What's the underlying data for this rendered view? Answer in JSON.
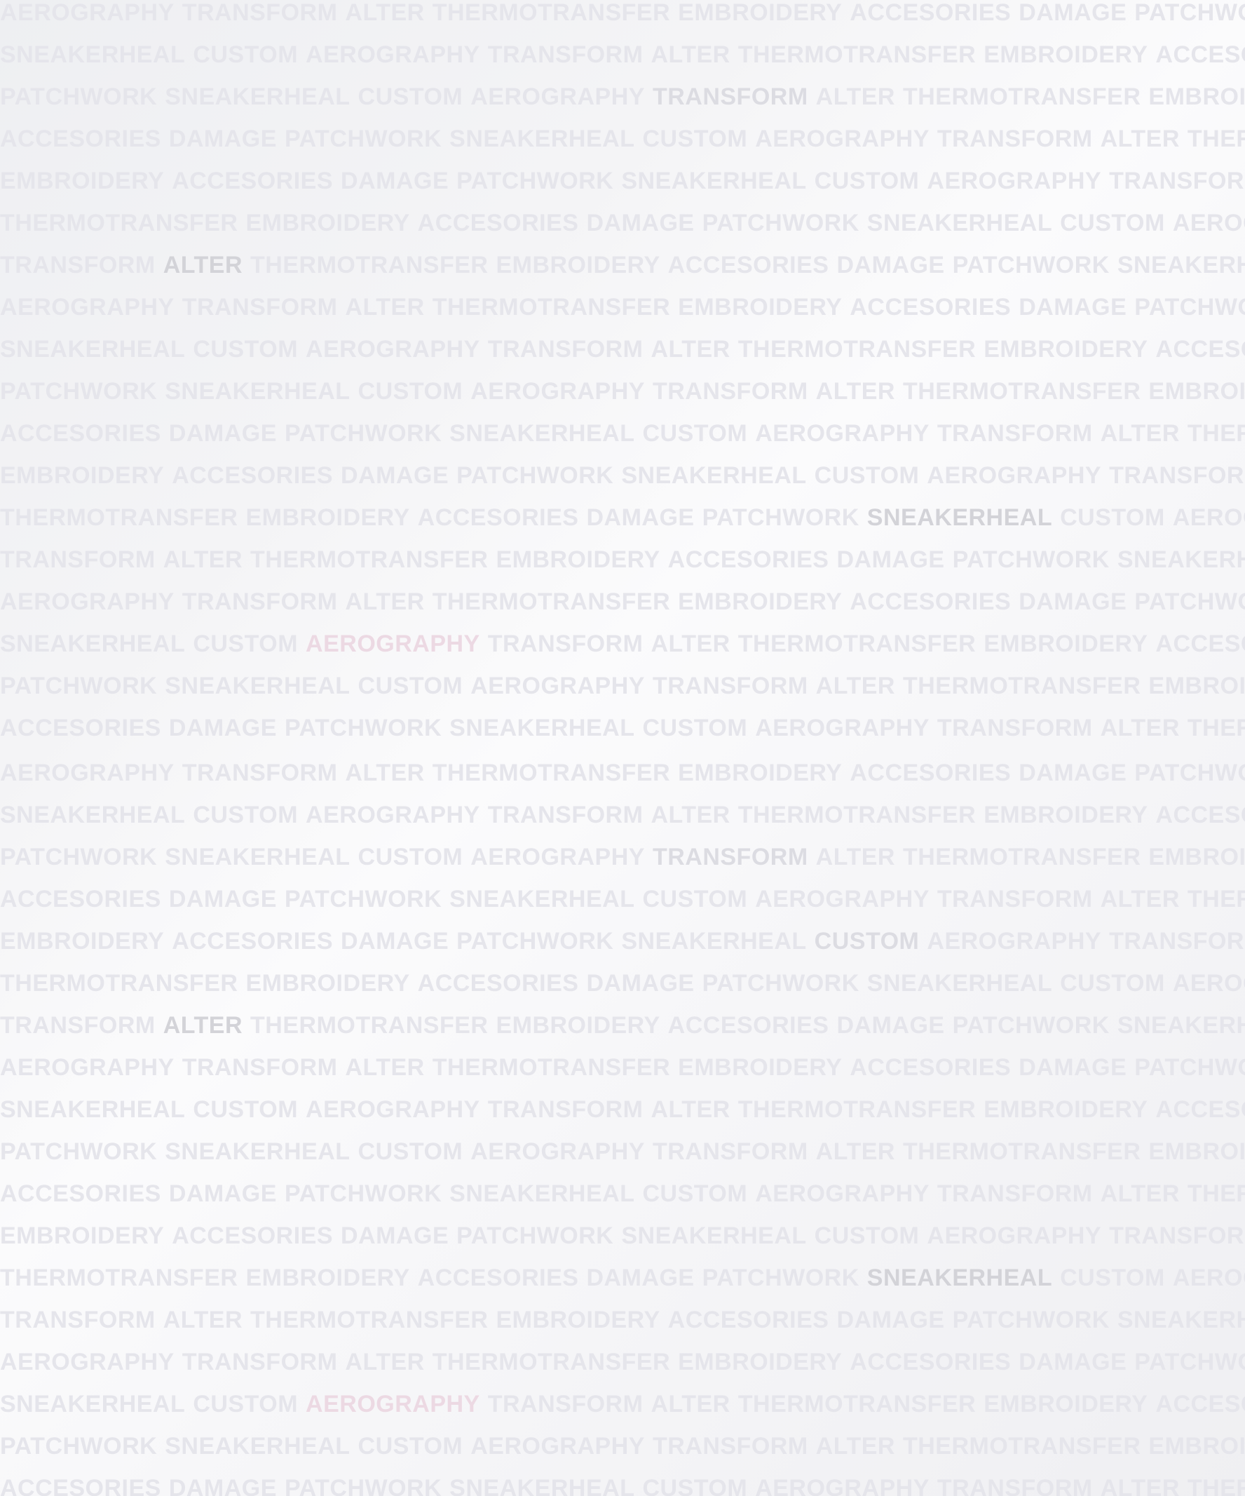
{
  "background_words": [
    "AEROGRAPHY",
    "TRANSFORM",
    "ALTER",
    "THERMOTRANSFER",
    "EMBROIDERY",
    "ACCESORIES",
    "DAMAGE",
    "PATCHWORK",
    "SNEAKERHEAL",
    "CUSTOM"
  ],
  "row_start_words": [
    "AEROGRAPHY",
    "SNEAKERHEAL",
    "PATCHWORK",
    "ACCESORIES",
    "EMBROIDERY",
    "THERMOTRANSFER",
    "TRANSFORM",
    "AEROGRAPHY",
    "SNEAKERHEAL",
    "PATCHWORK",
    "ACCESORIES",
    "EMBROIDERY",
    "THERMOTRANSFER",
    "TRANSFORM",
    "AEROGRAPHY",
    "SNEAKERHEAL",
    "PATCHWORK",
    "ACCESORIES",
    "AEROGRAPHY",
    "SNEAKERHEAL",
    "PATCHWORK",
    "ACCESORIES",
    "EMBROIDERY",
    "THERMOTRANSFER",
    "TRANSFORM",
    "AEROGRAPHY",
    "SNEAKERHEAL",
    "PATCHWORK",
    "ACCESORIES",
    "EMBROIDERY",
    "THERMOTRANSFER",
    "TRANSFORM",
    "AEROGRAPHY",
    "SNEAKERHEAL",
    "PATCHWORK",
    "ACCESORIES"
  ],
  "highlighted": [
    {
      "row": 2,
      "word": "TRANSFORM",
      "tone": "mid"
    },
    {
      "row": 6,
      "word": "ALTER",
      "tone": "gray"
    },
    {
      "row": 12,
      "word": "SNEAKERHEAL",
      "tone": "gray"
    },
    {
      "row": 15,
      "word": "AEROGRAPHY",
      "tone": "pink"
    },
    {
      "row": 20,
      "word": "TRANSFORM",
      "tone": "mid"
    },
    {
      "row": 22,
      "word": "CUSTOM",
      "tone": "mid"
    },
    {
      "row": 24,
      "word": "ALTER",
      "tone": "gray"
    },
    {
      "row": 30,
      "word": "SNEAKERHEAL",
      "tone": "gray"
    },
    {
      "row": 33,
      "word": "AEROGRAPHY",
      "tone": "pink"
    }
  ],
  "colors": {
    "background": "#f6f6f8",
    "word": "#e5e5eb",
    "highlight_gray": "#d3d3d8",
    "highlight_mid": "#dcdce2",
    "highlight_pink": "#ecd9e3"
  }
}
